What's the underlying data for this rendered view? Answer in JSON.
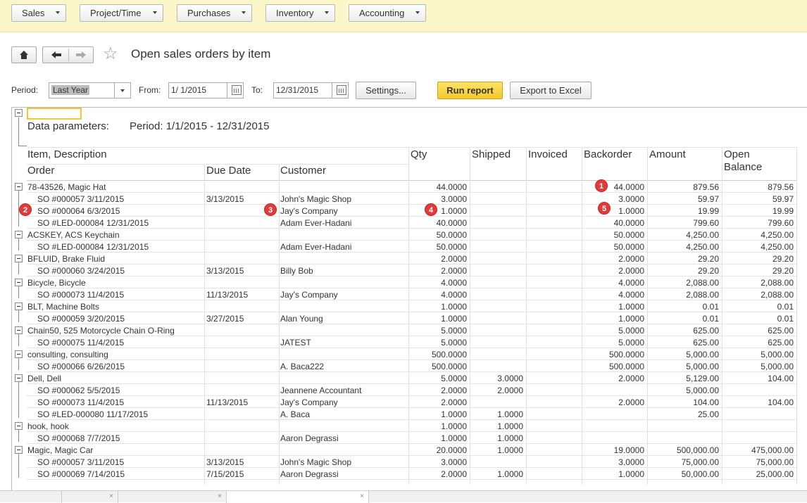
{
  "menu": [
    {
      "label": "Sales"
    },
    {
      "label": "Project/Time"
    },
    {
      "label": "Purchases"
    },
    {
      "label": "Inventory"
    },
    {
      "label": "Accounting"
    }
  ],
  "page_title": "Open sales orders by item",
  "filters": {
    "period_label": "Period:",
    "period_value": "Last Year",
    "from_label": "From:",
    "from_value": "1/ 1/2015",
    "to_label": "To:",
    "to_value": "12/31/2015",
    "settings_label": "Settings...",
    "run_label": "Run report",
    "export_label": "Export to Excel"
  },
  "report": {
    "params_label": "Data parameters:",
    "params_value": "Period: 1/1/2015 - 12/31/2015",
    "headers": {
      "item_description": "Item, Description",
      "order": "Order",
      "due_date": "Due Date",
      "customer": "Customer",
      "qty": "Qty",
      "shipped": "Shipped",
      "invoiced": "Invoiced",
      "backorder": "Backorder",
      "amount": "Amount",
      "open_balance_1": "Open",
      "open_balance_2": "Balance"
    },
    "rows": [
      {
        "group": true,
        "text": "78-43526, Magic Hat",
        "due": "",
        "customer": "",
        "qty": "44.0000",
        "shipped": "",
        "invoiced": "",
        "backorder": "44.0000",
        "amount": "879.56",
        "open": "879.56"
      },
      {
        "group": false,
        "text": "SO #000057 3/11/2015",
        "due": "3/13/2015",
        "customer": "John's Magic Shop",
        "qty": "3.0000",
        "shipped": "",
        "invoiced": "",
        "backorder": "3.0000",
        "amount": "59.97",
        "open": "59.97"
      },
      {
        "group": false,
        "text": "SO #000064 6/3/2015",
        "due": "",
        "customer": "Jay's Company",
        "qty": "1.0000",
        "shipped": "",
        "invoiced": "",
        "backorder": "1.0000",
        "amount": "19.99",
        "open": "19.99"
      },
      {
        "group": false,
        "text": "SO #LED-000084 12/31/2015",
        "due": "",
        "customer": "Adam Ever-Hadani",
        "qty": "40.0000",
        "shipped": "",
        "invoiced": "",
        "backorder": "40.0000",
        "amount": "799.60",
        "open": "799.60"
      },
      {
        "group": true,
        "text": "ACSKEY, ACS Keychain",
        "due": "",
        "customer": "",
        "qty": "50.0000",
        "shipped": "",
        "invoiced": "",
        "backorder": "50.0000",
        "amount": "4,250.00",
        "open": "4,250.00"
      },
      {
        "group": false,
        "text": "SO #LED-000084 12/31/2015",
        "due": "",
        "customer": "Adam Ever-Hadani",
        "qty": "50.0000",
        "shipped": "",
        "invoiced": "",
        "backorder": "50.0000",
        "amount": "4,250.00",
        "open": "4,250.00"
      },
      {
        "group": true,
        "text": "BFLUID, Brake Fluid",
        "due": "",
        "customer": "",
        "qty": "2.0000",
        "shipped": "",
        "invoiced": "",
        "backorder": "2.0000",
        "amount": "29.20",
        "open": "29.20"
      },
      {
        "group": false,
        "text": "SO #000060 3/24/2015",
        "due": "3/13/2015",
        "customer": "Billy Bob",
        "qty": "2.0000",
        "shipped": "",
        "invoiced": "",
        "backorder": "2.0000",
        "amount": "29.20",
        "open": "29.20"
      },
      {
        "group": true,
        "text": "Bicycle, Bicycle",
        "due": "",
        "customer": "",
        "qty": "4.0000",
        "shipped": "",
        "invoiced": "",
        "backorder": "4.0000",
        "amount": "2,088.00",
        "open": "2,088.00"
      },
      {
        "group": false,
        "text": "SO #000073 11/4/2015",
        "due": "11/13/2015",
        "customer": "Jay's Company",
        "qty": "4.0000",
        "shipped": "",
        "invoiced": "",
        "backorder": "4.0000",
        "amount": "2,088.00",
        "open": "2,088.00"
      },
      {
        "group": true,
        "text": "BLT, Machine Bolts",
        "due": "",
        "customer": "",
        "qty": "1.0000",
        "shipped": "",
        "invoiced": "",
        "backorder": "1.0000",
        "amount": "0.01",
        "open": "0.01"
      },
      {
        "group": false,
        "text": "SO #000059 3/20/2015",
        "due": "3/27/2015",
        "customer": "Alan Young",
        "qty": "1.0000",
        "shipped": "",
        "invoiced": "",
        "backorder": "1.0000",
        "amount": "0.01",
        "open": "0.01"
      },
      {
        "group": true,
        "text": "Chain50, 525 Motorcycle Chain O-Ring",
        "due": "",
        "customer": "",
        "qty": "5.0000",
        "shipped": "",
        "invoiced": "",
        "backorder": "5.0000",
        "amount": "625.00",
        "open": "625.00"
      },
      {
        "group": false,
        "text": "SO #000075 11/4/2015",
        "due": "",
        "customer": "JATEST",
        "qty": "5.0000",
        "shipped": "",
        "invoiced": "",
        "backorder": "5.0000",
        "amount": "625.00",
        "open": "625.00"
      },
      {
        "group": true,
        "text": "consulting, consulting",
        "due": "",
        "customer": "",
        "qty": "500.0000",
        "shipped": "",
        "invoiced": "",
        "backorder": "500.0000",
        "amount": "5,000.00",
        "open": "5,000.00"
      },
      {
        "group": false,
        "text": "SO #000066 6/26/2015",
        "due": "",
        "customer": "A. Baca222",
        "qty": "500.0000",
        "shipped": "",
        "invoiced": "",
        "backorder": "500.0000",
        "amount": "5,000.00",
        "open": "5,000.00"
      },
      {
        "group": true,
        "text": "Dell, Dell",
        "due": "",
        "customer": "",
        "qty": "5.0000",
        "shipped": "3.0000",
        "invoiced": "",
        "backorder": "2.0000",
        "amount": "5,129.00",
        "open": "104.00"
      },
      {
        "group": false,
        "text": "SO #000062 5/5/2015",
        "due": "",
        "customer": "Jeannene Accountant",
        "qty": "2.0000",
        "shipped": "2.0000",
        "invoiced": "",
        "backorder": "",
        "amount": "5,000.00",
        "open": ""
      },
      {
        "group": false,
        "text": "SO #000073 11/4/2015",
        "due": "11/13/2015",
        "customer": "Jay's Company",
        "qty": "2.0000",
        "shipped": "",
        "invoiced": "",
        "backorder": "2.0000",
        "amount": "104.00",
        "open": "104.00"
      },
      {
        "group": false,
        "text": "SO #LED-000080 11/17/2015",
        "due": "",
        "customer": "A. Baca",
        "qty": "1.0000",
        "shipped": "1.0000",
        "invoiced": "",
        "backorder": "",
        "amount": "25.00",
        "open": ""
      },
      {
        "group": true,
        "text": "hook, hook",
        "due": "",
        "customer": "",
        "qty": "1.0000",
        "shipped": "1.0000",
        "invoiced": "",
        "backorder": "",
        "amount": "",
        "open": ""
      },
      {
        "group": false,
        "text": "SO #000068 7/7/2015",
        "due": "",
        "customer": "Aaron Degrassi",
        "qty": "1.0000",
        "shipped": "1.0000",
        "invoiced": "",
        "backorder": "",
        "amount": "",
        "open": ""
      },
      {
        "group": true,
        "text": "Magic, Magic Car",
        "due": "",
        "customer": "",
        "qty": "20.0000",
        "shipped": "1.0000",
        "invoiced": "",
        "backorder": "19.0000",
        "amount": "500,000.00",
        "open": "475,000.00"
      },
      {
        "group": false,
        "text": "SO #000057 3/11/2015",
        "due": "3/13/2015",
        "customer": "John's Magic Shop",
        "qty": "3.0000",
        "shipped": "",
        "invoiced": "",
        "backorder": "3.0000",
        "amount": "75,000.00",
        "open": "75,000.00"
      },
      {
        "group": false,
        "text": "SO #000069 7/14/2015",
        "due": "7/15/2015",
        "customer": "Aaron Degrassi",
        "qty": "2.0000",
        "shipped": "1.0000",
        "invoiced": "",
        "backorder": "1.0000",
        "amount": "50,000.00",
        "open": "25,000.00"
      }
    ]
  },
  "badges": [
    "1",
    "2",
    "3",
    "4",
    "5"
  ],
  "colors": {
    "topbar": "#fbf7c8",
    "primary_button": "#f5c827",
    "badge": "#e23b3b"
  }
}
